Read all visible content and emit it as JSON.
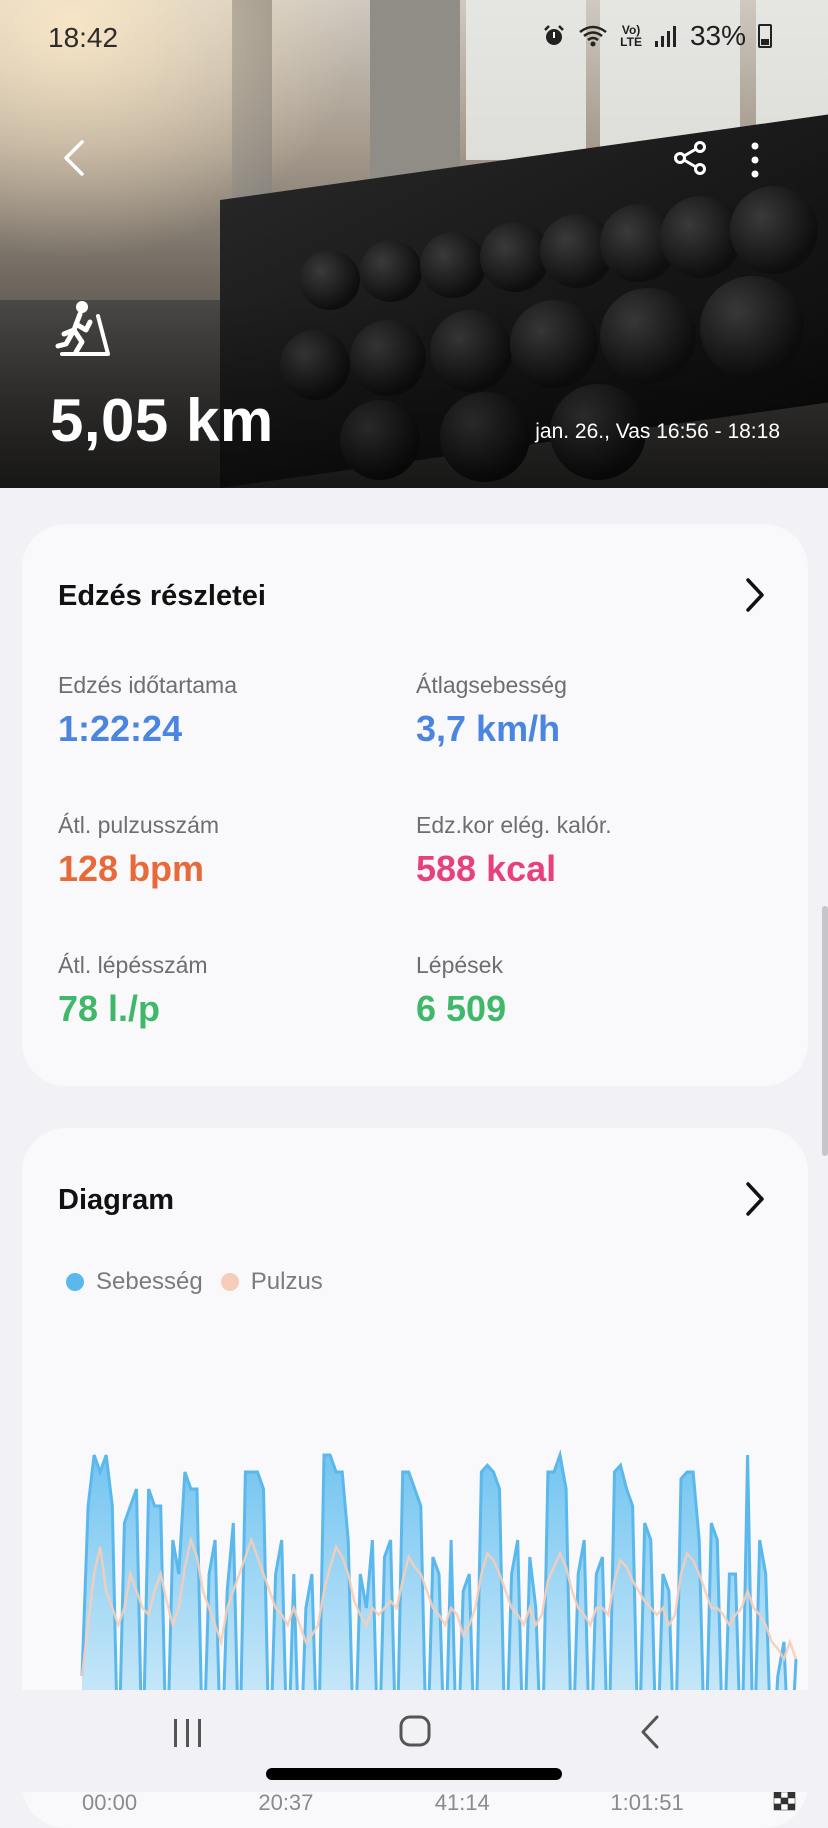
{
  "status_bar": {
    "time": "18:42",
    "battery": "33%",
    "volte_line1": "Vo)",
    "volte_line2": "LTE"
  },
  "header": {
    "distance": "5,05 km",
    "date_range": "jan. 26., Vas 16:56 - 18:18",
    "activity_icon": "treadmill-run-icon"
  },
  "details": {
    "title": "Edzés részletei",
    "metrics": [
      {
        "label": "Edzés időtartama",
        "value": "1:22:24",
        "color": "#4a86e0"
      },
      {
        "label": "Átlagsebesség",
        "value": "3,7 km/h",
        "color": "#4a86e0"
      },
      {
        "label": "Átl. pulzusszám",
        "value": "128 bpm",
        "color": "#e8693a"
      },
      {
        "label": "Edz.kor elég. kalór.",
        "value": "588 kcal",
        "color": "#e8407e"
      },
      {
        "label": "Átl. lépésszám",
        "value": "78 l./p",
        "color": "#3fb86a"
      },
      {
        "label": "Lépések",
        "value": "6 509",
        "color": "#3fb86a"
      }
    ]
  },
  "diagram": {
    "title": "Diagram",
    "legend": [
      {
        "name": "Sebesség",
        "color": "#5ab8ec"
      },
      {
        "name": "Pulzus",
        "color": "#f6cdb8"
      }
    ]
  },
  "chart_data": {
    "type": "area",
    "x_ticks": [
      "00:00",
      "20:37",
      "41:14",
      "1:01:51"
    ],
    "series": [
      {
        "name": "Sebesség",
        "color": "#5ab8ec",
        "values": [
          0.3,
          0.8,
          0.95,
          0.9,
          0.95,
          0.8,
          0,
          0.75,
          0.8,
          0.85,
          0,
          0.85,
          0.8,
          0.8,
          0,
          0.7,
          0.6,
          0.9,
          0.85,
          0.85,
          0,
          0.6,
          0.7,
          0,
          0.55,
          0.75,
          0,
          0.9,
          0.9,
          0.9,
          0.85,
          0,
          0.6,
          0.7,
          0,
          0.6,
          0,
          0.5,
          0.6,
          0,
          0.95,
          0.95,
          0.9,
          0.9,
          0.7,
          0,
          0.6,
          0.5,
          0.7,
          0,
          0.65,
          0.7,
          0,
          0.9,
          0.9,
          0.85,
          0.8,
          0,
          0.65,
          0.6,
          0,
          0.7,
          0,
          0.55,
          0.6,
          0,
          0.9,
          0.92,
          0.9,
          0.85,
          0,
          0.6,
          0.7,
          0,
          0.65,
          0.5,
          0,
          0.9,
          0.9,
          0.95,
          0.85,
          0,
          0.6,
          0.7,
          0,
          0.6,
          0.65,
          0,
          0.9,
          0.92,
          0.85,
          0.8,
          0,
          0.75,
          0.7,
          0,
          0.6,
          0.55,
          0,
          0.88,
          0.9,
          0.9,
          0.7,
          0,
          0.75,
          0.7,
          0,
          0.6,
          0.6,
          0,
          0.95,
          0,
          0.7,
          0.6,
          0,
          0.3,
          0.4,
          0,
          0.35
        ]
      },
      {
        "name": "Pulzus",
        "color": "#f6cdb8",
        "values": [
          0.3,
          0.45,
          0.6,
          0.68,
          0.55,
          0.5,
          0.45,
          0.5,
          0.6,
          0.55,
          0.5,
          0.48,
          0.55,
          0.6,
          0.52,
          0.45,
          0.5,
          0.62,
          0.7,
          0.65,
          0.55,
          0.5,
          0.45,
          0.4,
          0.5,
          0.55,
          0.6,
          0.65,
          0.7,
          0.65,
          0.6,
          0.55,
          0.5,
          0.48,
          0.45,
          0.5,
          0.45,
          0.4,
          0.42,
          0.45,
          0.55,
          0.62,
          0.68,
          0.65,
          0.6,
          0.52,
          0.48,
          0.45,
          0.5,
          0.48,
          0.5,
          0.52,
          0.5,
          0.58,
          0.65,
          0.62,
          0.6,
          0.55,
          0.5,
          0.48,
          0.45,
          0.5,
          0.48,
          0.42,
          0.45,
          0.5,
          0.6,
          0.66,
          0.64,
          0.6,
          0.55,
          0.5,
          0.48,
          0.45,
          0.5,
          0.45,
          0.48,
          0.58,
          0.62,
          0.66,
          0.62,
          0.55,
          0.5,
          0.48,
          0.45,
          0.5,
          0.5,
          0.48,
          0.58,
          0.64,
          0.62,
          0.58,
          0.55,
          0.52,
          0.5,
          0.48,
          0.5,
          0.45,
          0.48,
          0.6,
          0.66,
          0.64,
          0.6,
          0.55,
          0.5,
          0.5,
          0.48,
          0.45,
          0.48,
          0.5,
          0.55,
          0.5,
          0.48,
          0.45,
          0.4,
          0.38,
          0.35,
          0.4,
          0.35
        ]
      }
    ],
    "ylim": [
      0,
      1
    ],
    "grid": false,
    "legend_position": "top-left"
  }
}
